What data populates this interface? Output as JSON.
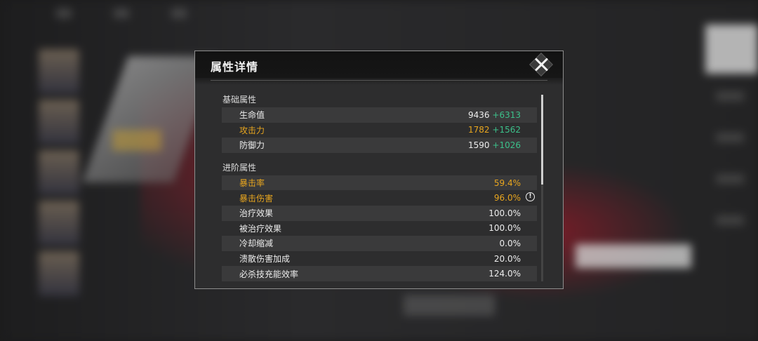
{
  "modal": {
    "title": "属性详情",
    "sections": [
      {
        "title": "基础属性",
        "rows": [
          {
            "label": "生命值",
            "base": "9436",
            "bonus": "+6313",
            "highlight": false
          },
          {
            "label": "攻击力",
            "base": "1782",
            "bonus": "+1562",
            "highlight": true
          },
          {
            "label": "防御力",
            "base": "1590",
            "bonus": "+1026",
            "highlight": false
          }
        ]
      },
      {
        "title": "进阶属性",
        "rows": [
          {
            "label": "暴击率",
            "value": "59.4%",
            "highlight": true
          },
          {
            "label": "暴击伤害",
            "value": "96.0%",
            "highlight": true,
            "icon": "exclamation-info-icon"
          },
          {
            "label": "治疗效果",
            "value": "100.0%",
            "highlight": false
          },
          {
            "label": "被治疗效果",
            "value": "100.0%",
            "highlight": false
          },
          {
            "label": "冷却缩减",
            "value": "0.0%",
            "highlight": false
          },
          {
            "label": "溃散伤害加成",
            "value": "20.0%",
            "highlight": false
          },
          {
            "label": "必杀技充能效率",
            "value": "124.0%",
            "highlight": false
          }
        ]
      }
    ],
    "info_glyph": "!"
  },
  "colors": {
    "highlight": "#e7a51f",
    "bonus": "#3cc08a",
    "panel_bg": "#2d2d2e"
  },
  "icons": {
    "close": "close-icon",
    "info": "exclamation-info-icon"
  }
}
